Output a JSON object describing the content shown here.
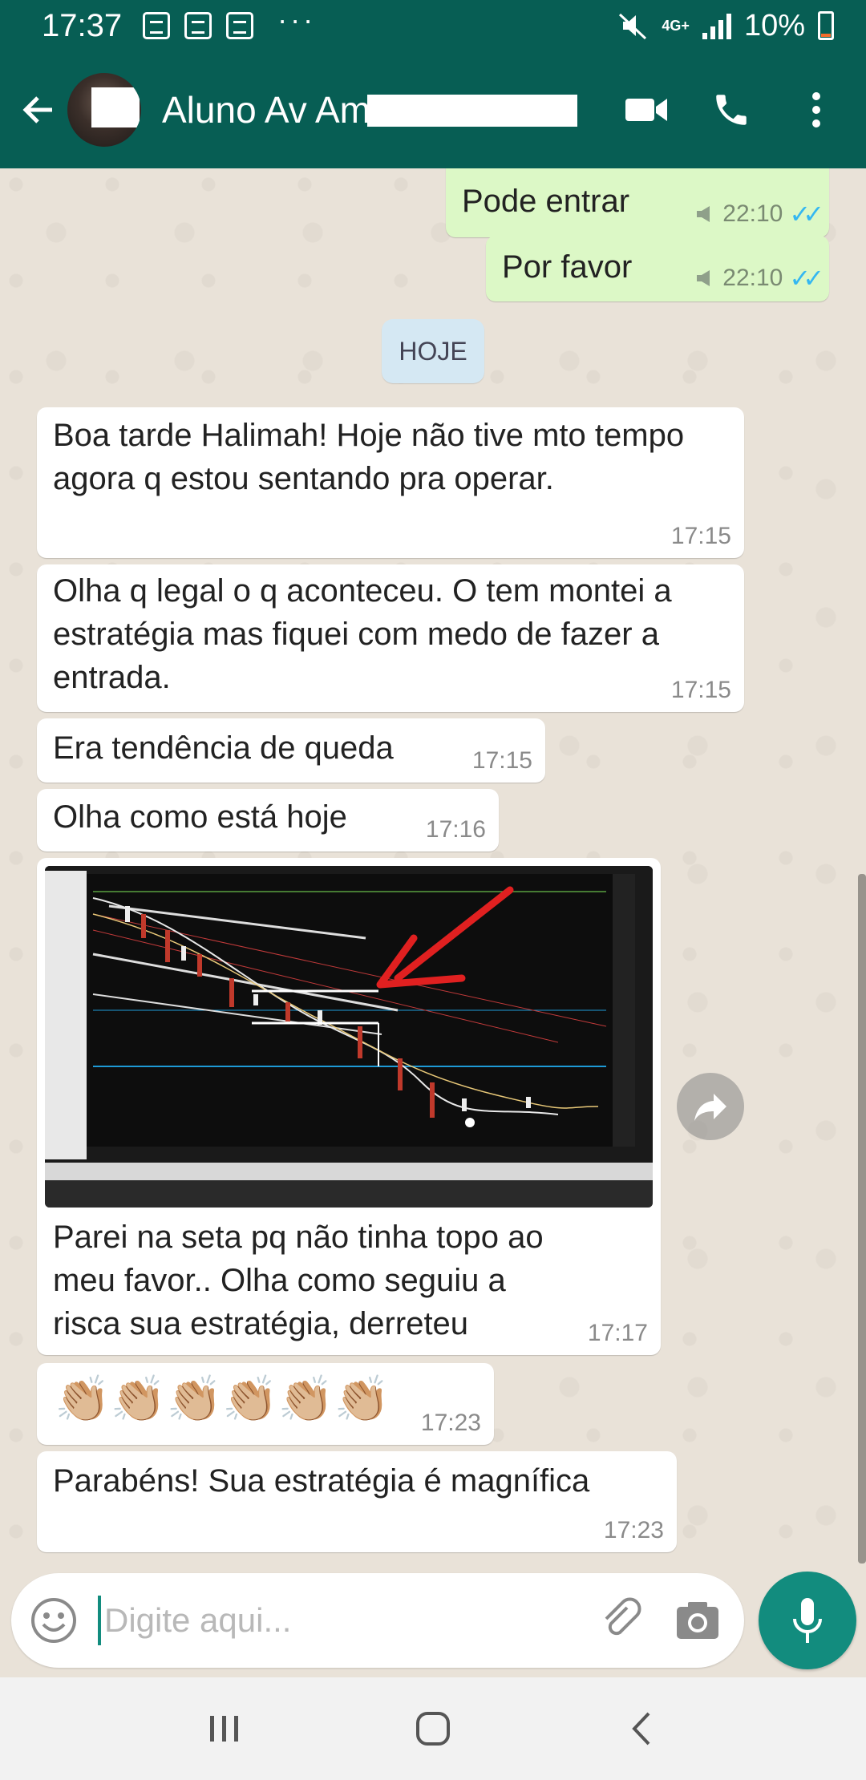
{
  "status_bar": {
    "time": "17:37",
    "network": "4G+",
    "battery": "10%",
    "dots": "···"
  },
  "header": {
    "contact_name": "Aluno Av Am",
    "icons": [
      "back-arrow-icon",
      "video-call-icon",
      "phone-icon",
      "more-vert-icon"
    ]
  },
  "messages": {
    "m1": {
      "text": "Pode entrar",
      "time": "22:10"
    },
    "m2": {
      "text": "Por favor",
      "time": "22:10"
    },
    "date_divider": "HOJE",
    "m3": {
      "text": "Boa tarde Halimah! Hoje não tive mto tempo agora q estou sentando pra operar.",
      "time": "17:15"
    },
    "m4": {
      "text": "Olha q legal o q aconteceu. O tem montei a estratégia mas fiquei com medo de fazer a entrada.",
      "time": "17:15"
    },
    "m5": {
      "text": "Era tendência de queda",
      "time": "17:15"
    },
    "m6": {
      "text": "Olha como está hoje",
      "time": "17:16"
    },
    "m7": {
      "text": "Parei na seta pq não tinha topo ao meu favor.. Olha como seguiu a risca sua estratégia, derreteu",
      "time": "17:17"
    },
    "m8": {
      "text": "👏🏼👏🏼👏🏼👏🏼👏🏼👏🏼",
      "time": "17:23"
    },
    "m9": {
      "text": "Parabéns! Sua estratégia é magnífica",
      "time": "17:23"
    }
  },
  "composer": {
    "placeholder": "Digite aqui..."
  },
  "colors": {
    "header": "#075e54",
    "outgoing_bubble": "#dcf8c6",
    "incoming_bubble": "#ffffff",
    "accent": "#128c7e",
    "read_ticks": "#34b7f1"
  }
}
